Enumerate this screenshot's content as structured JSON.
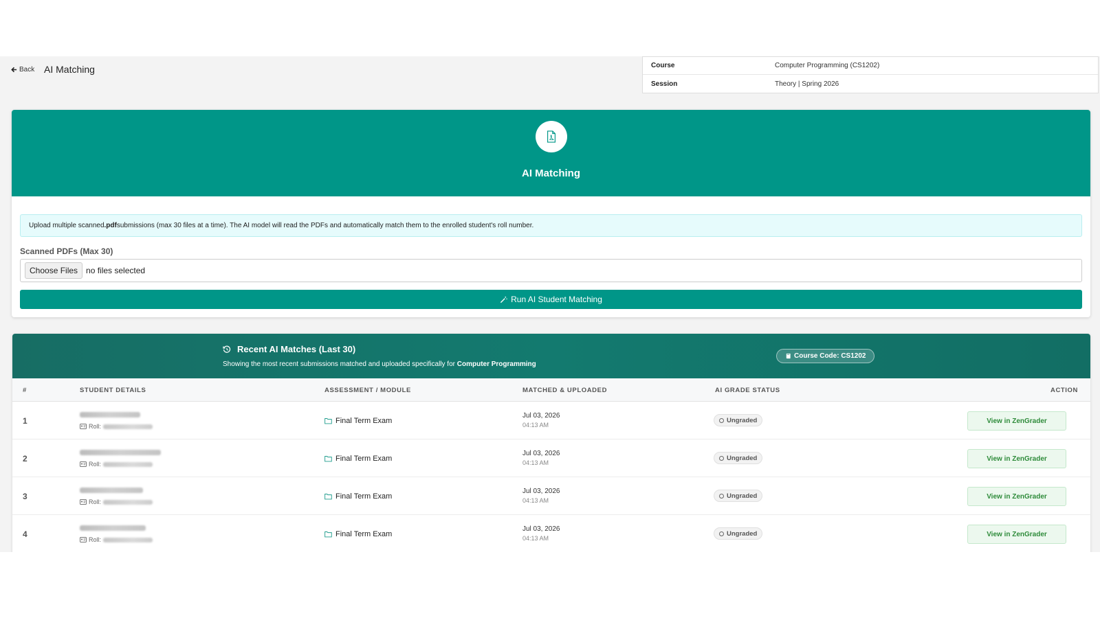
{
  "header": {
    "back_label": "Back",
    "page_title": "AI Matching"
  },
  "course_info": {
    "rows": [
      {
        "key": "Course",
        "value": "Computer Programming (CS1202)"
      },
      {
        "key": "Session",
        "value": "Theory | Spring 2026"
      }
    ]
  },
  "upload": {
    "hero_title": "AI Matching",
    "notice_pre": "Upload multiple scanned ",
    "notice_bold": ".pdf",
    "notice_post": " submissions (max 30 files at a time). The AI model will read the PDFs and automatically match them to the enrolled student's roll number.",
    "field_label": "Scanned PDFs (Max 30)",
    "choose_label": "Choose Files",
    "file_status": "no files selected",
    "run_label": "Run AI Student Matching"
  },
  "recent": {
    "title": "Recent AI Matches (Last 30)",
    "subtitle_pre": "Showing the most recent submissions matched and uploaded specifically for ",
    "subtitle_bold": "Computer Programming",
    "course_badge": "Course Code: CS1202",
    "columns": [
      "#",
      "STUDENT DETAILS",
      "ASSESSMENT / MODULE",
      "MATCHED & UPLOADED",
      "AI GRADE STATUS",
      "ACTION"
    ],
    "rows": [
      {
        "num": "1",
        "roll_label": "Roll:",
        "assessment": "Final Term Exam",
        "date": "Jul 03, 2026",
        "time": "04:13 AM",
        "status": "Ungraded",
        "action": "View in ZenGrader"
      },
      {
        "num": "2",
        "roll_label": "Roll:",
        "assessment": "Final Term Exam",
        "date": "Jul 03, 2026",
        "time": "04:13 AM",
        "status": "Ungraded",
        "action": "View in ZenGrader"
      },
      {
        "num": "3",
        "roll_label": "Roll:",
        "assessment": "Final Term Exam",
        "date": "Jul 03, 2026",
        "time": "04:13 AM",
        "status": "Ungraded",
        "action": "View in ZenGrader"
      },
      {
        "num": "4",
        "roll_label": "Roll:",
        "assessment": "Final Term Exam",
        "date": "Jul 03, 2026",
        "time": "04:13 AM",
        "status": "Ungraded",
        "action": "View in ZenGrader"
      }
    ]
  },
  "colors": {
    "primary": "#009688",
    "header_dark": "#137a6f",
    "notice_bg": "#e6fbfc",
    "action_green": "#2e8b3a"
  },
  "icons": {
    "back": "arrow-left-icon",
    "hero": "pdf-file-icon",
    "run": "magic-wand-icon",
    "recent": "history-icon",
    "badge": "book-icon",
    "folder": "folder-icon",
    "id": "id-card-icon",
    "status": "circle-outline-icon"
  }
}
